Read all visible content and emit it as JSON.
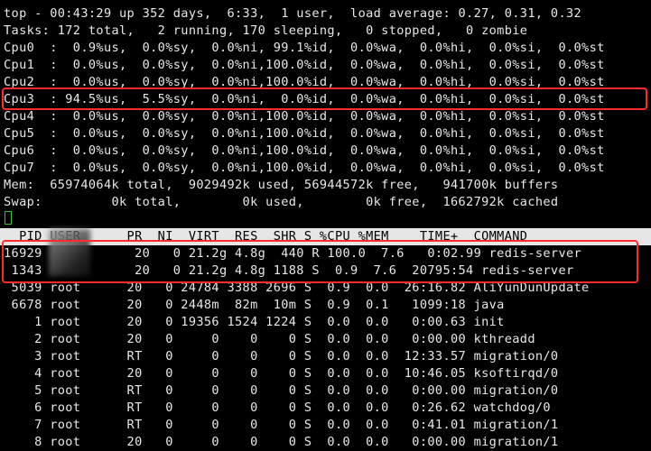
{
  "summary": {
    "uptime": "top - 00:43:29 up 352 days,  6:33,  1 user,  load average: 0.27, 0.31, 0.32",
    "tasks": "Tasks: 172 total,   2 running, 170 sleeping,   0 stopped,   0 zombie"
  },
  "cpus": [
    "Cpu0  :  0.9%us,  0.0%sy,  0.0%ni, 99.1%id,  0.0%wa,  0.0%hi,  0.0%si,  0.0%st",
    "Cpu1  :  0.0%us,  0.0%sy,  0.0%ni,100.0%id,  0.0%wa,  0.0%hi,  0.0%si,  0.0%st",
    "Cpu2  :  0.0%us,  0.0%sy,  0.0%ni,100.0%id,  0.0%wa,  0.0%hi,  0.0%si,  0.0%st",
    "Cpu3  : 94.5%us,  5.5%sy,  0.0%ni,  0.0%id,  0.0%wa,  0.0%hi,  0.0%si,  0.0%st",
    "Cpu4  :  0.0%us,  0.0%sy,  0.0%ni,100.0%id,  0.0%wa,  0.0%hi,  0.0%si,  0.0%st",
    "Cpu5  :  0.0%us,  0.0%sy,  0.0%ni,100.0%id,  0.0%wa,  0.0%hi,  0.0%si,  0.0%st",
    "Cpu6  :  0.0%us,  0.0%sy,  0.0%ni,100.0%id,  0.0%wa,  0.0%hi,  0.0%si,  0.0%st",
    "Cpu7  :  0.0%us,  0.0%sy,  0.0%ni,100.0%id,  0.0%wa,  0.0%hi,  0.0%si,  0.0%st"
  ],
  "memory": {
    "mem": "Mem:  65974064k total,  9029492k used, 56944572k free,   941700k buffers",
    "swap": "Swap:         0k total,        0k used,        0k free,  1662792k cached"
  },
  "process_header": "  PID USER      PR  NI  VIRT  RES  SHR S %CPU %MEM    TIME+  COMMAND",
  "processes": [
    "16929            20   0 21.2g 4.8g  440 R 100.0  7.6   0:02.99 redis-server",
    " 1343            20   0 21.2g 4.8g 1188 S  0.9  7.6  20795:54 redis-server",
    " 5039 root      20   0 24784 3388 2696 S  0.9  0.0  26:16.82 AliYunDunUpdate",
    " 6678 root      20   0 2448m  82m  10m S  0.9  0.1   1099:18 java",
    "    1 root      20   0 19356 1524 1224 S  0.0  0.0   0:00.63 init",
    "    2 root      20   0     0    0    0 S  0.0  0.0   0:00.00 kthreadd",
    "    3 root      RT   0     0    0    0 S  0.0  0.0  12:33.57 migration/0",
    "    4 root      20   0     0    0    0 S  0.0  0.0  10:46.05 ksoftirqd/0",
    "    5 root      RT   0     0    0    0 S  0.0  0.0   0:00.00 migration/0",
    "    6 root      RT   0     0    0    0 S  0.0  0.0   0:26.62 watchdog/0",
    "    7 root      RT   0     0    0    0 S  0.0  0.0   0:41.01 migration/1",
    "    8 root      20   0     0    0    0 S  0.0  0.0   0:00.00 migration/1"
  ],
  "colors": {
    "background": "#000000",
    "text": "#e8e8e8",
    "header_bg": "#e6e6e6",
    "highlight": "#ff2a2a",
    "cursor": "#30c030"
  }
}
